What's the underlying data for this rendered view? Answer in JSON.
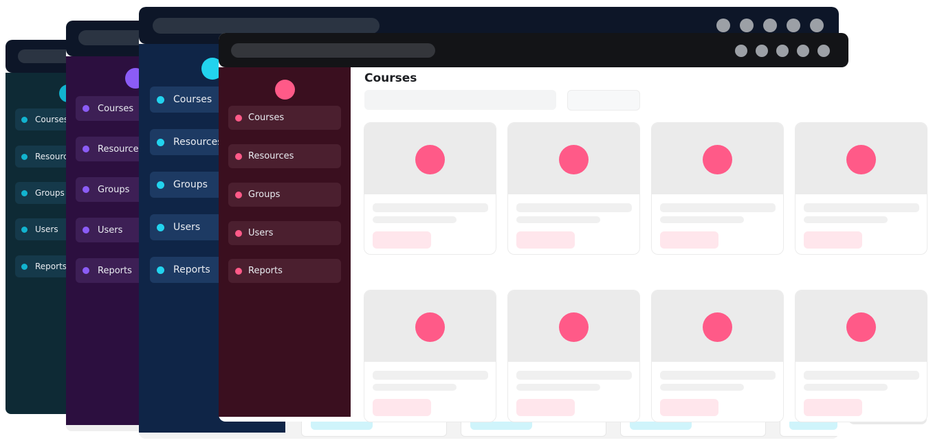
{
  "colors": {
    "teal_dark": "#0e2a35",
    "teal_accent": "#12b3cf",
    "purple_dark": "#2c0f3f",
    "purple_accent": "#8b5cf6",
    "navy_dark": "#0f2547",
    "cyan_accent": "#22d3ee",
    "maroon_dark": "#3a0f1f",
    "pink_accent": "#ff5a88",
    "titlebar_black": "#131417",
    "titlebar_navy": "#0d1628"
  },
  "windows": [
    {
      "theme": "teal",
      "nav": [
        "Courses",
        "Resourc",
        "Groups",
        "Users",
        "Reports"
      ]
    },
    {
      "theme": "purple",
      "nav": [
        "Courses",
        "Resources",
        "Groups",
        "Users",
        "Reports"
      ]
    },
    {
      "theme": "navy",
      "nav": [
        "Courses",
        "Resources",
        "Groups",
        "Users",
        "Reports"
      ]
    },
    {
      "theme": "maroon",
      "nav": [
        "Courses",
        "Resources",
        "Groups",
        "Users",
        "Reports"
      ],
      "page_title": "Courses"
    }
  ]
}
